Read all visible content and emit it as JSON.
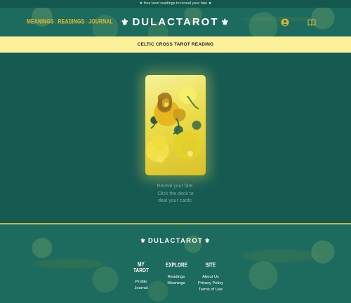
{
  "topbar": {
    "text": "★ free tarot readings to reveal your fate ★"
  },
  "nav": {
    "links": [
      "MEANINGS",
      "READINGS",
      "JOURNAL"
    ],
    "logo": "DULACTAROT"
  },
  "banner": {
    "text": "CELTIC CROSS TAROT READING"
  },
  "main": {
    "hint_lines": [
      "Reveal your fate.",
      "Click the deck to",
      "deal your cards."
    ]
  },
  "footer": {
    "logo": "DULACTAROT",
    "columns": [
      {
        "title": "MY TAROT",
        "links": [
          "Profile",
          "Journal"
        ]
      },
      {
        "title": "EXPLORE",
        "links": [
          "Readings",
          "Meanings"
        ]
      },
      {
        "title": "SITE",
        "links": [
          "About Us",
          "Privacy Policy",
          "Terms of Use"
        ]
      }
    ]
  },
  "colors": {
    "teal": "#165a52",
    "gold": "#d8b63a",
    "banner": "#fcf09a"
  }
}
